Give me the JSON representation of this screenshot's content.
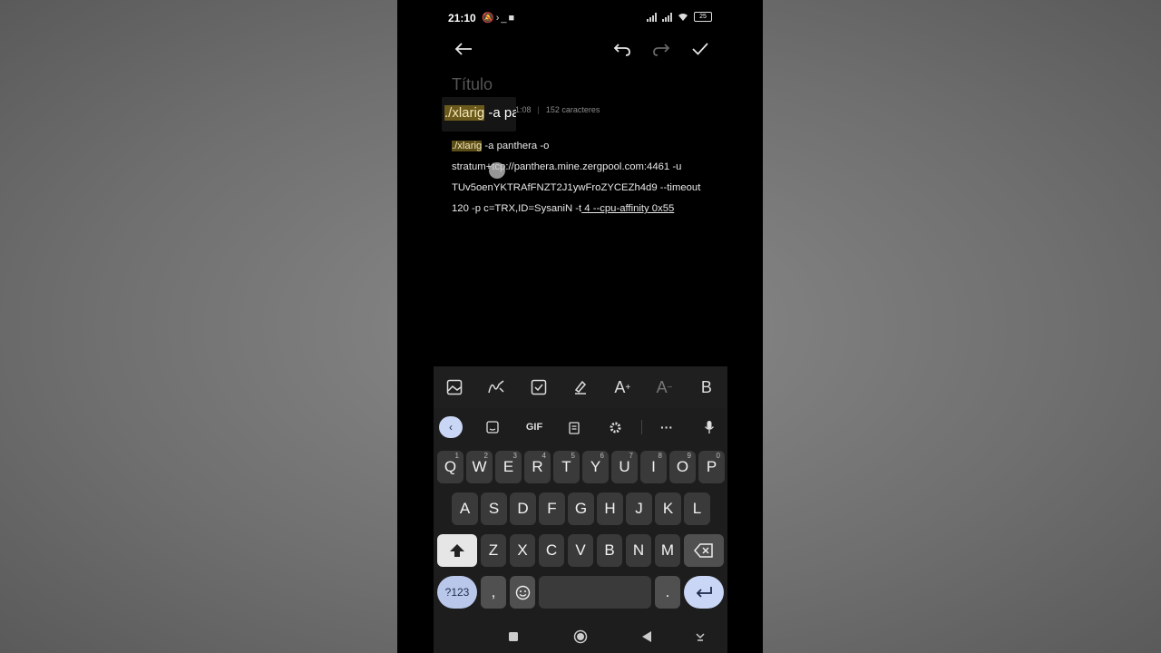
{
  "status": {
    "time": "21:10",
    "battery": "25"
  },
  "editor": {
    "title_placeholder": "Título",
    "meta_time": "1:08",
    "meta_chars": "152 caracteres",
    "zoom_highlight": "./xlarig",
    "zoom_rest": " -a pa",
    "lines": [
      {
        "hl": "./xlarig",
        "text": " -a panthera -o"
      },
      {
        "hl": "",
        "text": "stratum+tcp://panthera.mine.zergpool.com:4461 -u"
      },
      {
        "hl": "",
        "text": "TUv5oenYKTRAfFNZT2J1ywFroZYCEZh4d9 --timeout"
      },
      {
        "hl": "",
        "text": "120 -p  c=TRX,ID=SysaniN -t",
        "u": " 4 --cpu-affinity 0x55"
      }
    ]
  },
  "format_toolbar": {
    "font_up": "A",
    "font_down": "A",
    "bold": "B"
  },
  "keyboard": {
    "gif": "GIF",
    "row1": [
      "Q",
      "W",
      "E",
      "R",
      "T",
      "Y",
      "U",
      "I",
      "O",
      "P"
    ],
    "row1_nums": [
      "1",
      "2",
      "3",
      "4",
      "5",
      "6",
      "7",
      "8",
      "9",
      "0"
    ],
    "row2": [
      "A",
      "S",
      "D",
      "F",
      "G",
      "H",
      "J",
      "K",
      "L"
    ],
    "row3": [
      "Z",
      "X",
      "C",
      "V",
      "B",
      "N",
      "M"
    ],
    "symbols": "?123",
    "comma": ",",
    "period": "."
  }
}
